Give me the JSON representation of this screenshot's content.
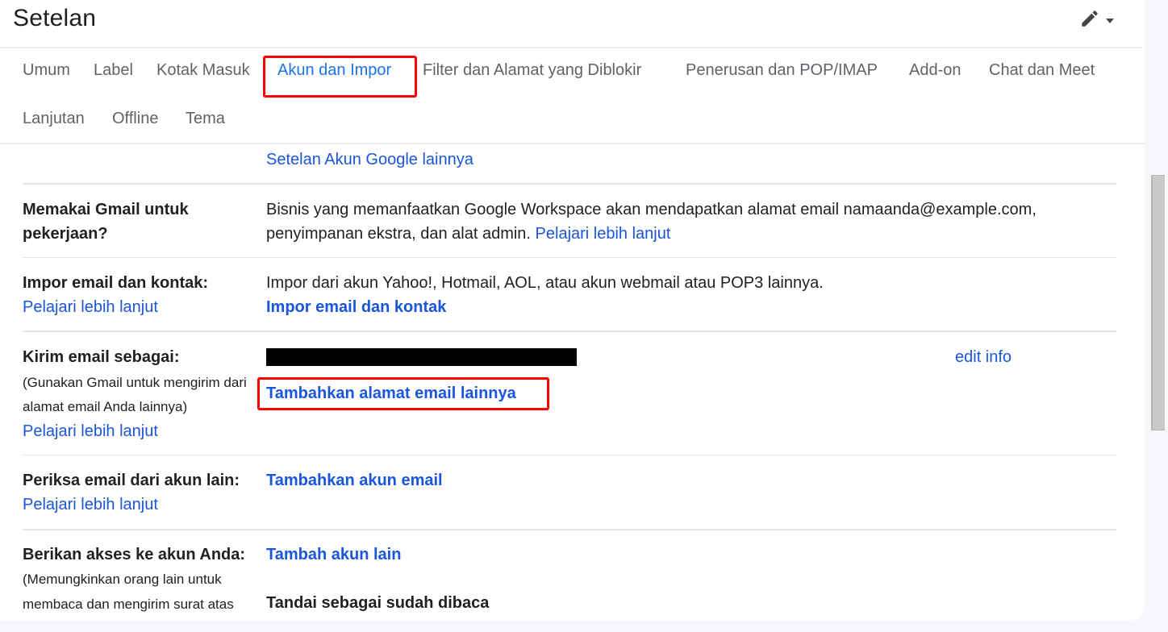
{
  "header": {
    "title": "Setelan",
    "edit_icon": "pencil-icon",
    "dropdown_icon": "caret-down-icon"
  },
  "tabs": [
    {
      "label": "Umum",
      "active": false
    },
    {
      "label": "Label",
      "active": false
    },
    {
      "label": "Kotak Masuk",
      "active": false
    },
    {
      "label": "Akun dan Impor",
      "active": true
    },
    {
      "label": "Filter dan Alamat yang Diblokir",
      "active": false
    },
    {
      "label": "Penerusan dan POP/IMAP",
      "active": false
    },
    {
      "label": "Add-on",
      "active": false
    },
    {
      "label": "Chat dan Meet",
      "active": false
    },
    {
      "label": "Lanjutan",
      "active": false
    },
    {
      "label": "Offline",
      "active": false
    },
    {
      "label": "Tema",
      "active": false
    }
  ],
  "colors": {
    "accent": "#1a73e8",
    "link": "#1a56db",
    "highlight": "#ff0000"
  },
  "sections": {
    "account_settings": {
      "link": "Setelan Akun Google lainnya"
    },
    "gmail_for_work": {
      "label_line1": "Memakai Gmail untuk",
      "label_line2": "pekerjaan?",
      "text_line1": "Bisnis yang memanfaatkan Google Workspace akan mendapatkan alamat email namaanda@example.com,",
      "text_line2": "penyimpanan ekstra, dan alat admin.",
      "learn_more": "Pelajari lebih lanjut"
    },
    "import": {
      "label": "Impor email dan kontak:",
      "learn_more": "Pelajari lebih lanjut",
      "text": "Impor dari akun Yahoo!, Hotmail, AOL, atau akun webmail atau POP3 lainnya.",
      "action": "Impor email dan kontak"
    },
    "send_as": {
      "label": "Kirim email sebagai:",
      "desc_line1": "(Gunakan Gmail untuk mengirim dari",
      "desc_line2": "alamat email Anda lainnya)",
      "learn_more": "Pelajari lebih lanjut",
      "edit_info": "edit info",
      "add_address": "Tambahkan alamat email lainnya"
    },
    "check_mail": {
      "label": "Periksa email dari akun lain:",
      "learn_more": "Pelajari lebih lanjut",
      "action": "Tambahkan akun email"
    },
    "grant_access": {
      "label": "Berikan akses ke akun Anda:",
      "desc_line1": "(Memungkinkan orang lain untuk",
      "desc_line2": "membaca dan mengirim surat atas",
      "action": "Tambah akun lain",
      "mark_read_heading": "Tandai sebagai sudah dibaca"
    }
  }
}
